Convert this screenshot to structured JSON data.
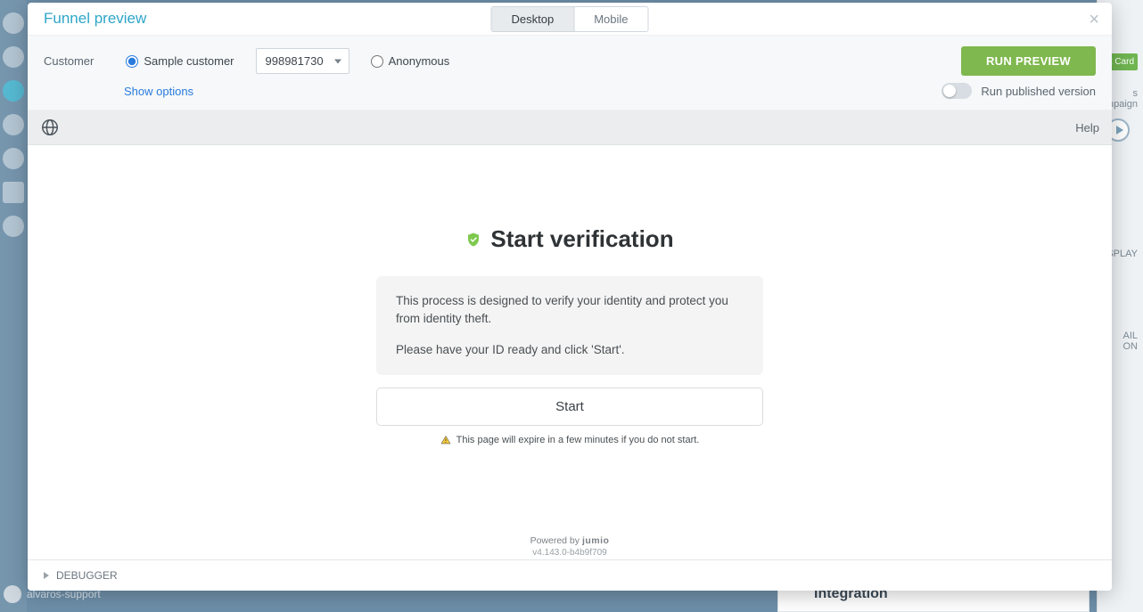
{
  "modal": {
    "title": "Funnel preview",
    "view_tabs": {
      "desktop": "Desktop",
      "mobile": "Mobile"
    },
    "customer_label": "Customer",
    "sample_label": "Sample customer",
    "sample_id": "998981730",
    "anon_label": "Anonymous",
    "run_label": "RUN PREVIEW",
    "show_options": "Show options",
    "run_published": "Run published version",
    "help": "Help"
  },
  "verification": {
    "title": "Start verification",
    "line1": "This process is designed to verify your identity and protect you from identity theft.",
    "line2": "Please have your ID ready and click 'Start'.",
    "start": "Start",
    "expire": "This page will expire in a few minutes if you do not start.",
    "powered_prefix": "Powered by ",
    "powered_brand": "jumio",
    "version": "v4.143.0-b4b9f709"
  },
  "footer": {
    "debugger": "DEBUGGER"
  },
  "background": {
    "credit": "dit Card",
    "tags_s": "s",
    "campaign": "ampaign",
    "display": "SPLAY",
    "detail": "AIL",
    "on": "ON",
    "integration": "Integration",
    "user": "alvaros-support"
  }
}
